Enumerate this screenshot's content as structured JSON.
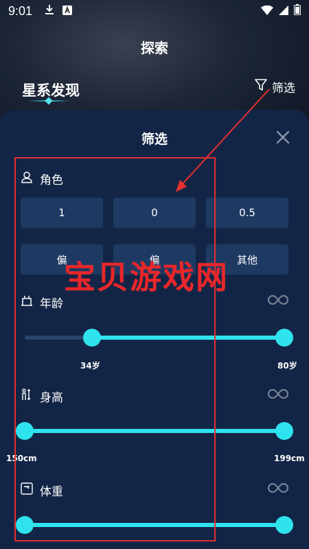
{
  "status_bar": {
    "time": "9:01"
  },
  "header": {
    "title": "探索",
    "section_title": "星系发现",
    "filter_label": "筛选"
  },
  "sheet": {
    "title": "筛选",
    "role": {
      "label": "角色",
      "options": [
        "1",
        "0",
        "0.5",
        "偏",
        "偏",
        "其他"
      ]
    },
    "age": {
      "label": "年龄",
      "min_label": "34岁",
      "max_label": "80岁",
      "selected_range_fraction": [
        0.25,
        1.0
      ]
    },
    "height": {
      "label": "身高",
      "min_label": "150cm",
      "max_label": "199cm",
      "selected_range_fraction": [
        0.0,
        1.0
      ]
    },
    "weight": {
      "label": "体重",
      "selected_range_fraction": [
        0.0,
        1.0
      ]
    }
  },
  "overlay": {
    "watermark": "宝贝游戏网"
  },
  "colors": {
    "accent": "#2fe3ee",
    "sheet_bg": "#132546",
    "option_bg": "#1e3a63",
    "annotation_red": "#e53030"
  }
}
